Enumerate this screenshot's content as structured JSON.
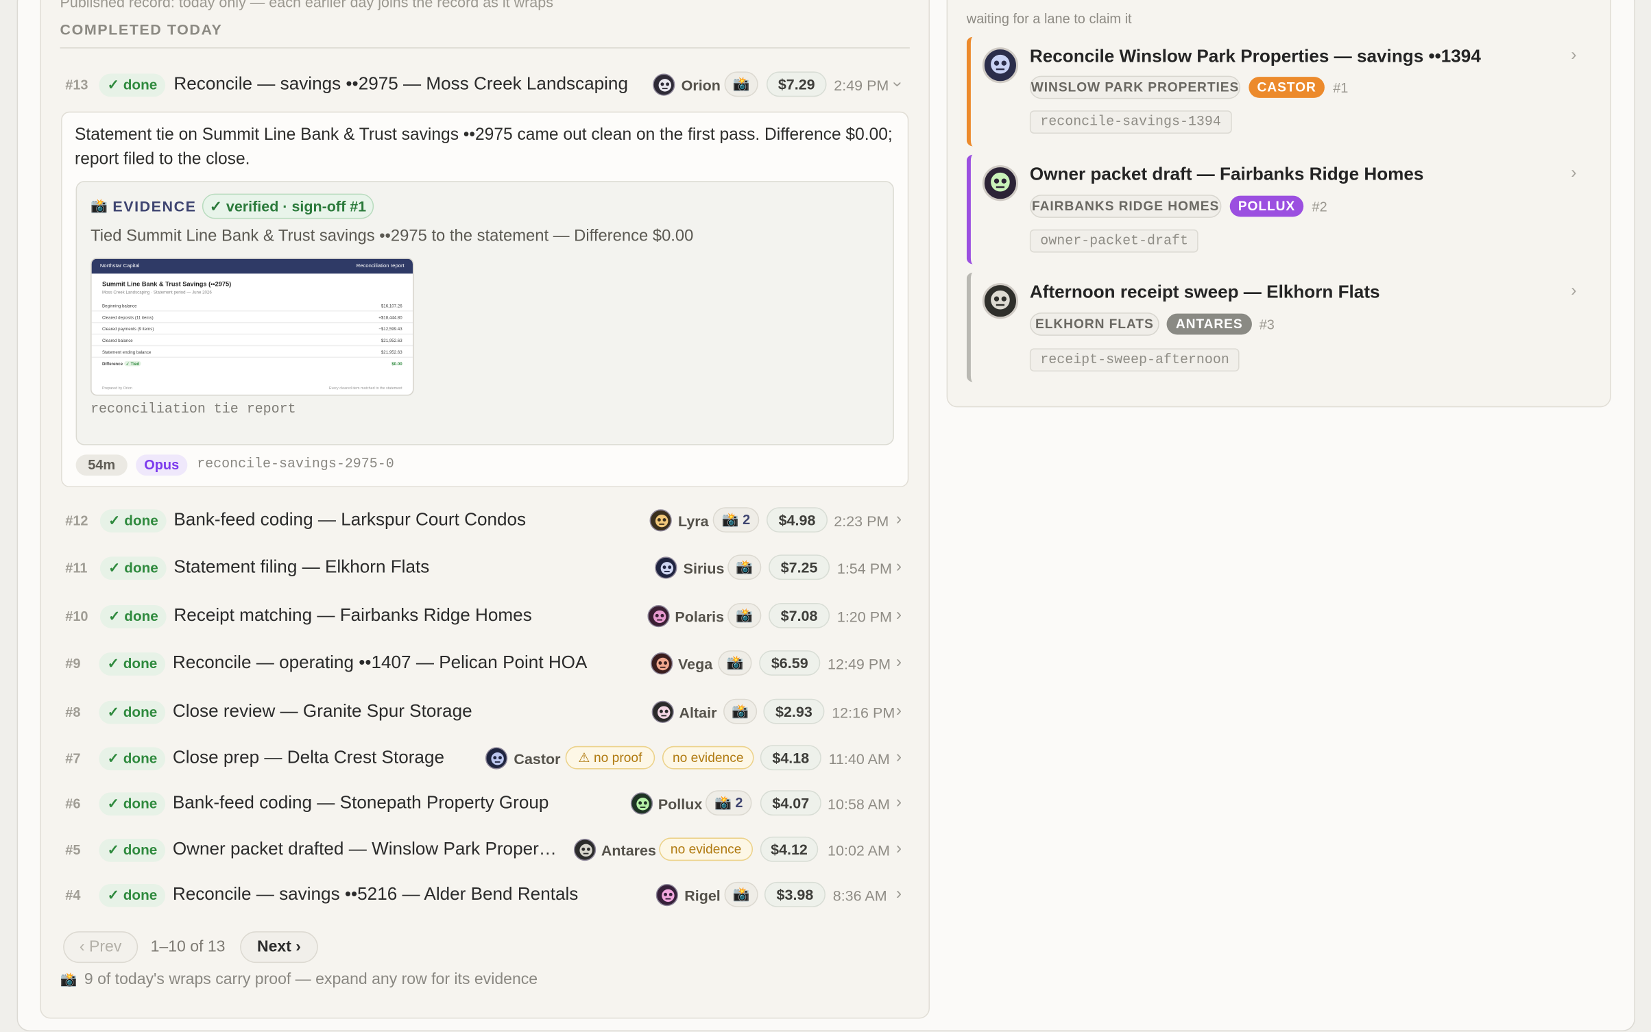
{
  "top_note": "Published record: today only — each earlier day joins the record as it wraps",
  "section_title": "COMPLETED TODAY",
  "expanded": {
    "num": "#13",
    "status": "✓ done",
    "title": "Reconcile — savings ••2975 — Moss Creek Landscaping",
    "agent": "Orion",
    "proof": "📸",
    "cost": "$7.29",
    "time": "2:49 PM",
    "summary": "Statement tie on Summit Line Bank & Trust savings ••2975 came out clean on the first pass. Difference $0.00; report filed to the close.",
    "evidence_label": "EVIDENCE",
    "evidence_icon": "📸",
    "verified": "✓ verified · sign-off #1",
    "evidence_desc": "Tied Summit Line Bank & Trust savings ••2975 to the statement — Difference $0.00",
    "thumb": {
      "firm": "Northstar Capital",
      "doc": "Reconciliation report",
      "heading": "Summit Line Bank & Trust Savings (••2975)",
      "sub": "Moss Creek Landscaping · Statement period — June 2026",
      "rows": [
        {
          "label": "Beginning balance",
          "value": "$16,107.26"
        },
        {
          "label": "Cleared deposits (11 items)",
          "value": "+$18,444.80"
        },
        {
          "label": "Cleared payments (9 items)",
          "value": "−$12,599.43"
        },
        {
          "label": "Cleared balance",
          "value": "$21,952.63"
        },
        {
          "label": "Statement ending balance",
          "value": "$21,952.63"
        },
        {
          "label": "Difference",
          "value": "$0.00",
          "tag": "✓ Tied"
        }
      ],
      "prepared": "Prepared by Orion",
      "footnote": "Every cleared item matched to the statement"
    },
    "caption": "reconciliation tie report",
    "duration": "54m",
    "model": "Opus",
    "slug": "reconcile-savings-2975-0"
  },
  "rows": [
    {
      "num": "#12",
      "status": "✓ done",
      "title": "Bank-feed coding — Larkspur Court Condos",
      "agent": "Lyra",
      "proof": "📸 2",
      "cost": "$4.98",
      "time": "2:23 PM"
    },
    {
      "num": "#11",
      "status": "✓ done",
      "title": "Statement filing — Elkhorn Flats",
      "agent": "Sirius",
      "proof": "📸",
      "cost": "$7.25",
      "time": "1:54 PM"
    },
    {
      "num": "#10",
      "status": "✓ done",
      "title": "Receipt matching — Fairbanks Ridge Homes",
      "agent": "Polaris",
      "proof": "📸",
      "cost": "$7.08",
      "time": "1:20 PM"
    },
    {
      "num": "#9",
      "status": "✓ done",
      "title": "Reconcile — operating ••1407 — Pelican Point HOA",
      "agent": "Vega",
      "proof": "📸",
      "cost": "$6.59",
      "time": "12:49 PM"
    },
    {
      "num": "#8",
      "status": "✓ done",
      "title": "Close review — Granite Spur Storage",
      "agent": "Altair",
      "proof": "📸",
      "cost": "$2.93",
      "time": "12:16 PM"
    },
    {
      "num": "#7",
      "status": "✓ done",
      "title": "Close prep — Delta Crest Storage",
      "agent": "Castor",
      "warn1": "⚠ no proof",
      "warn2": "no evidence",
      "cost": "$4.18",
      "time": "11:40 AM"
    },
    {
      "num": "#6",
      "status": "✓ done",
      "title": "Bank-feed coding — Stonepath Property Group",
      "agent": "Pollux",
      "proof": "📸 2",
      "cost": "$4.07",
      "time": "10:58 AM"
    },
    {
      "num": "#5",
      "status": "✓ done",
      "title": "Owner packet drafted — Winslow Park Proper…",
      "agent": "Antares",
      "warn2": "no evidence",
      "cost": "$4.12",
      "time": "10:02 AM"
    },
    {
      "num": "#4",
      "status": "✓ done",
      "title": "Reconcile — savings ••5216 — Alder Bend Rentals",
      "agent": "Rigel",
      "proof": "📸",
      "cost": "$3.98",
      "time": "8:36 AM"
    }
  ],
  "pager": {
    "prev": "‹ Prev",
    "range": "1–10 of 13",
    "next": "Next ›"
  },
  "footer_icon": "📸",
  "footer": "9 of today's wraps carry proof — expand any row for its evidence",
  "queue": {
    "subtitle": "waiting for a lane to claim it",
    "items": [
      {
        "title": "Reconcile Winslow Park Properties — savings ••1394",
        "client": "WINSLOW PARK PROPERTIES",
        "lane": "CASTOR",
        "lane_color": "#ec8a2c",
        "rank": "#1",
        "slug": "reconcile-savings-1394"
      },
      {
        "title": "Owner packet draft — Fairbanks Ridge Homes",
        "client": "FAIRBANKS RIDGE HOMES",
        "lane": "POLLUX",
        "lane_color": "#9b4fe0",
        "rank": "#2",
        "slug": "owner-packet-draft"
      },
      {
        "title": "Afternoon receipt sweep — Elkhorn Flats",
        "client": "ELKHORN FLATS",
        "lane": "ANTARES",
        "lane_color": "#8a8a84",
        "rank": "#3",
        "slug": "receipt-sweep-afternoon"
      }
    ]
  },
  "colors": {
    "done": "#2f8a3e",
    "accent": "#3e4470",
    "warn": "#b07a10",
    "opus": "#7c3aed"
  }
}
